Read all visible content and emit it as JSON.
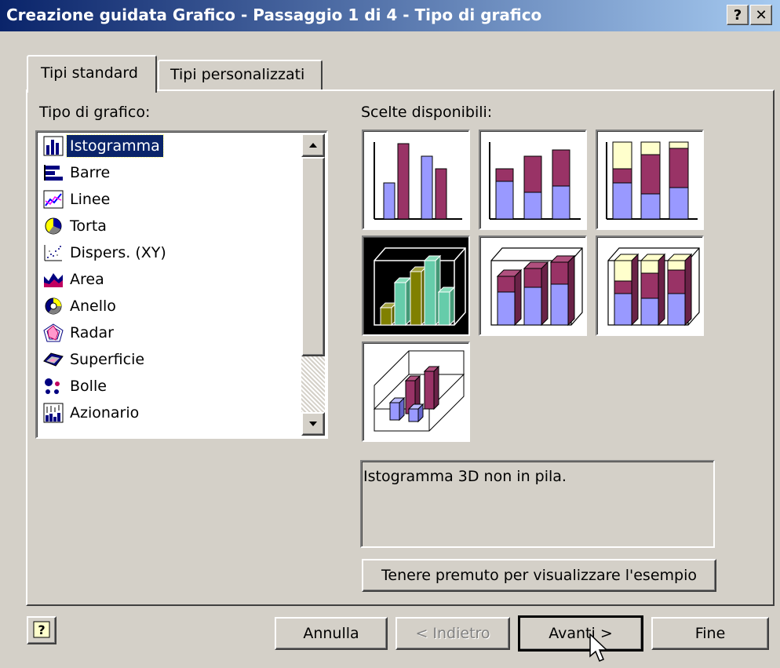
{
  "window": {
    "title": "Creazione guidata Grafico - Passaggio 1 di 4 - Tipo di grafico",
    "help_button": "?",
    "close_button": "✕"
  },
  "tabs": [
    {
      "label": "Tipi standard",
      "active": true
    },
    {
      "label": "Tipi personalizzati",
      "active": false
    }
  ],
  "chart_type_label": "Tipo di grafico:",
  "subtype_label": "Scelte disponibili:",
  "chart_types": [
    {
      "label": "Istogramma",
      "icon": "column-chart-icon",
      "selected": true
    },
    {
      "label": "Barre",
      "icon": "bar-chart-icon"
    },
    {
      "label": "Linee",
      "icon": "line-chart-icon"
    },
    {
      "label": "Torta",
      "icon": "pie-chart-icon"
    },
    {
      "label": "Dispers. (XY)",
      "icon": "scatter-chart-icon"
    },
    {
      "label": "Area",
      "icon": "area-chart-icon"
    },
    {
      "label": "Anello",
      "icon": "doughnut-chart-icon"
    },
    {
      "label": "Radar",
      "icon": "radar-chart-icon"
    },
    {
      "label": "Superficie",
      "icon": "surface-chart-icon"
    },
    {
      "label": "Bolle",
      "icon": "bubble-chart-icon"
    },
    {
      "label": "Azionario",
      "icon": "stock-chart-icon"
    }
  ],
  "subtypes_selected_index": 3,
  "description": "Istogramma 3D non in pila.",
  "preview_button": "Tenere premuto per visualizzare l'esempio",
  "footer": {
    "help_icon": "?",
    "cancel": "Annulla",
    "back": "< Indietro",
    "next": "Avanti >",
    "finish": "Fine"
  },
  "colors": {
    "titlebar_start": "#0a246a",
    "titlebar_end": "#a6caf0",
    "bar_blue": "#9999ff",
    "bar_maroon": "#993366",
    "bar_cream": "#ffffcc",
    "selected_bar_green": "#66ccaa",
    "selected_bar_olive": "#808000"
  }
}
